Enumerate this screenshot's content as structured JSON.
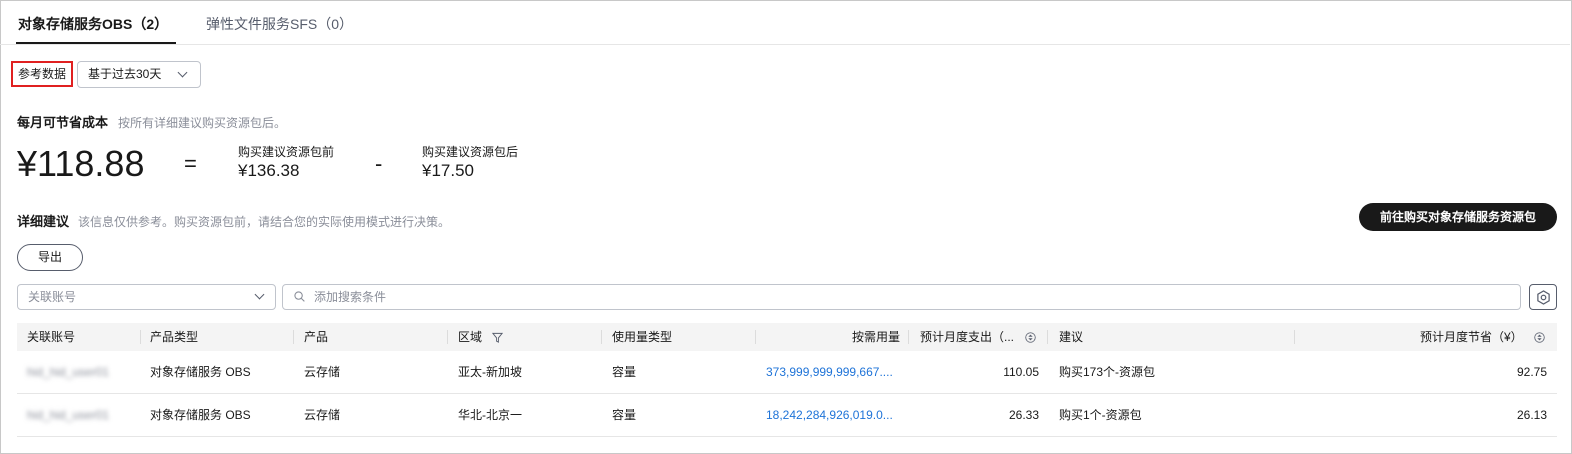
{
  "tabs": [
    {
      "label": "对象存储服务OBS（2）",
      "active": true
    },
    {
      "label": "弹性文件服务SFS（0）",
      "active": false
    }
  ],
  "reference": {
    "label": "参考数据",
    "period": "基于过去30天"
  },
  "savings": {
    "title": "每月可节省成本",
    "description": "按所有详细建议购买资源包后。",
    "amount": "¥118.88",
    "equals": "=",
    "minus": "-",
    "before_label": "购买建议资源包前",
    "before_value": "¥136.38",
    "after_label": "购买建议资源包后",
    "after_value": "¥17.50"
  },
  "detail": {
    "title": "详细建议",
    "description": "该信息仅供参考。购买资源包前，请结合您的实际使用模式进行决策。",
    "buy_button": "前往购买对象存储服务资源包",
    "export_button": "导出"
  },
  "filters": {
    "account_placeholder": "关联账号",
    "search_placeholder": "添加搜索条件"
  },
  "table": {
    "columns": [
      "关联账号",
      "产品类型",
      "产品",
      "区域",
      "使用量类型",
      "按需用量",
      "预计月度支出（...",
      "建议",
      "预计月度节省（¥）"
    ],
    "rows": [
      {
        "account": "hid_hid_user01",
        "product_type": "对象存储服务 OBS",
        "product": "云存储",
        "region": "亚太-新加坡",
        "usage_type": "容量",
        "usage": "373,999,999,999,667....",
        "monthly_cost": "110.05",
        "suggestion": "购买173个-资源包",
        "savings": "92.75"
      },
      {
        "account": "hid_hid_user01",
        "product_type": "对象存储服务 OBS",
        "product": "云存储",
        "region": "华北-北京一",
        "usage_type": "容量",
        "usage": "18,242,284,926,019.0...",
        "monthly_cost": "26.33",
        "suggestion": "购买1个-资源包",
        "savings": "26.13"
      }
    ]
  },
  "colors": {
    "link": "#1e73d8",
    "highlight_border": "#e02020",
    "primary_button": "#191919"
  }
}
